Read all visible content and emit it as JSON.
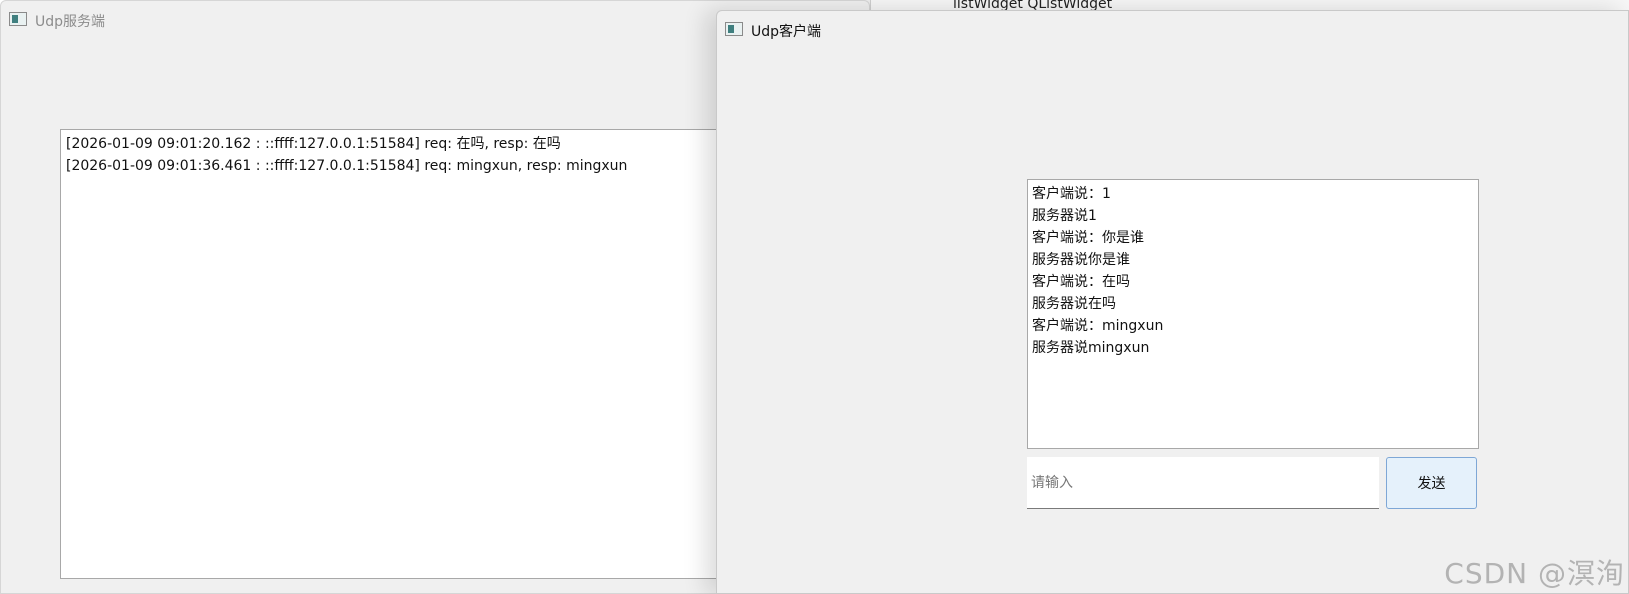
{
  "background_window": {
    "label": "listWidget QListWidget"
  },
  "server": {
    "title": "Udp服务端",
    "log": [
      "[2026-01-09 09:01:20.162 : ::ffff:127.0.0.1:51584] req: 在吗, resp: 在吗",
      "[2026-01-09 09:01:36.461 : ::ffff:127.0.0.1:51584] req: mingxun, resp: mingxun"
    ]
  },
  "client": {
    "title": "Udp客户端",
    "messages": [
      "客户端说：1",
      "服务器说1",
      "客户端说：你是谁",
      "服务器说你是谁",
      "客户端说：在吗",
      "服务器说在吗",
      "客户端说：mingxun",
      "服务器说mingxun"
    ],
    "input": {
      "value": "",
      "placeholder": "请输入"
    },
    "send_label": "发送"
  },
  "watermark": "CSDN @溟洵",
  "icons": {
    "app": "window-app-icon"
  },
  "colors": {
    "window_bg": "#f0f0f0",
    "button_bg": "#e5f1fb",
    "button_border": "#7ea7d6"
  }
}
